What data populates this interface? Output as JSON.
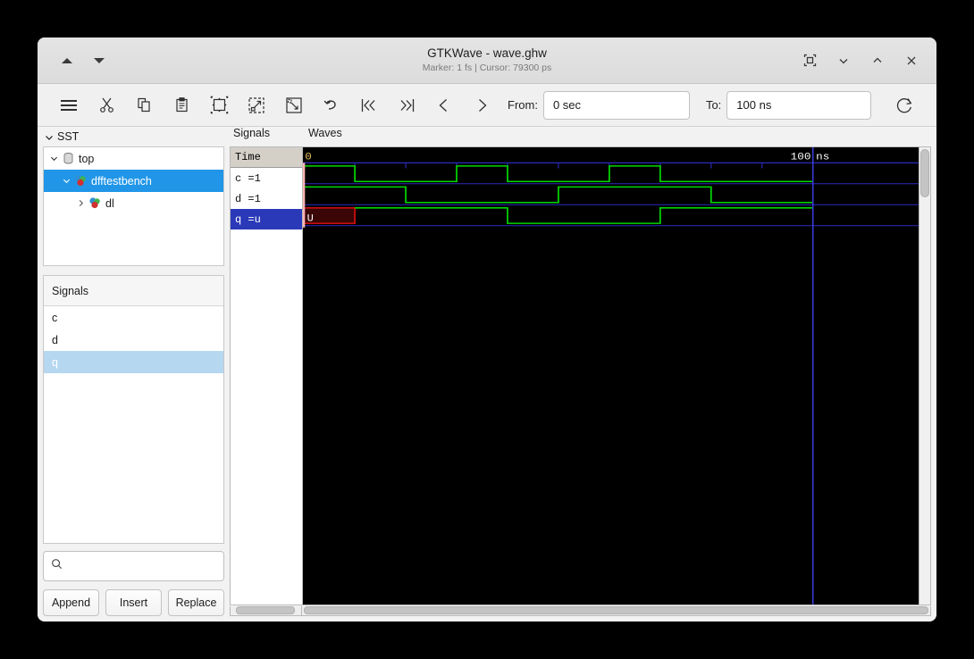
{
  "window": {
    "title": "GTKWave - wave.ghw",
    "subtitle": "Marker: 1 fs  |  Cursor: 79300 ps",
    "nav_up": "▲",
    "nav_down": "▼"
  },
  "toolbar": {
    "from_label": "From:",
    "from_value": "0 sec",
    "to_label": "To:",
    "to_value": "100 ns",
    "icons": [
      "menu-icon",
      "cut-icon",
      "copy-icon",
      "paste-icon",
      "zoom-fit-icon",
      "zoom-in-icon",
      "zoom-out-icon",
      "undo-icon",
      "go-first-icon",
      "go-last-icon",
      "go-prev-icon",
      "go-next-icon",
      "reload-icon"
    ]
  },
  "sidebar": {
    "sst_label": "SST",
    "tree": [
      {
        "label": "top",
        "depth": 0,
        "expanded": true,
        "selected": false,
        "icon": "cylinder-icon"
      },
      {
        "label": "dfftestbench",
        "depth": 1,
        "expanded": true,
        "selected": true,
        "icon": "cube-icon"
      },
      {
        "label": "dl",
        "depth": 2,
        "expanded": false,
        "selected": false,
        "icon": "cube-icon"
      }
    ],
    "signals_header": "Signals",
    "signals": [
      {
        "label": "c",
        "selected": false
      },
      {
        "label": "d",
        "selected": false
      },
      {
        "label": "q",
        "selected": true
      }
    ],
    "search_placeholder": "",
    "search_value": "",
    "buttons": {
      "append": "Append",
      "insert": "Insert",
      "replace": "Replace"
    }
  },
  "wave": {
    "signals_col_title": "Signals",
    "waves_col_title": "Waves",
    "time_header": "Time",
    "rows": [
      {
        "label": "c =1",
        "selected": false
      },
      {
        "label": "d =1",
        "selected": false
      },
      {
        "label": "q =u",
        "selected": true
      }
    ],
    "ruler": {
      "start_label": "0",
      "end_label": "100 ns"
    },
    "undefined_value_label": "U"
  },
  "colors": {
    "wave_bg": "#000000",
    "wave_trace": "#00d800",
    "wave_grid": "#2b2bbd",
    "undefined_border": "#e01010",
    "undefined_fill": "#3a0606",
    "marker_line": "#ffb3b3",
    "cursor_line": "#3a3ad8",
    "ruler_text": "#ffffff",
    "zero_text": "#e8c060",
    "selection_blue": "#2196e8",
    "row_selection": "#2a39b8"
  },
  "chart_data": {
    "type": "line",
    "title": "Waves",
    "xlabel": "Time (ns)",
    "xlim": [
      0,
      100
    ],
    "tick_interval_ns": 10,
    "series": [
      {
        "name": "c",
        "kind": "digital",
        "transitions": [
          {
            "t": 0,
            "v": 1
          },
          {
            "t": 10,
            "v": 0
          },
          {
            "t": 30,
            "v": 1
          },
          {
            "t": 40,
            "v": 0
          },
          {
            "t": 60,
            "v": 1
          },
          {
            "t": 70,
            "v": 0
          },
          {
            "t": 100,
            "v": 0
          }
        ]
      },
      {
        "name": "d",
        "kind": "digital",
        "transitions": [
          {
            "t": 0,
            "v": 1
          },
          {
            "t": 20,
            "v": 0
          },
          {
            "t": 50,
            "v": 1
          },
          {
            "t": 80,
            "v": 0
          },
          {
            "t": 100,
            "v": 0
          }
        ]
      },
      {
        "name": "q",
        "kind": "digital",
        "transitions": [
          {
            "t": 0,
            "v": "U"
          },
          {
            "t": 10,
            "v": 1
          },
          {
            "t": 40,
            "v": 0
          },
          {
            "t": 70,
            "v": 1
          },
          {
            "t": 100,
            "v": 1
          }
        ]
      }
    ]
  }
}
